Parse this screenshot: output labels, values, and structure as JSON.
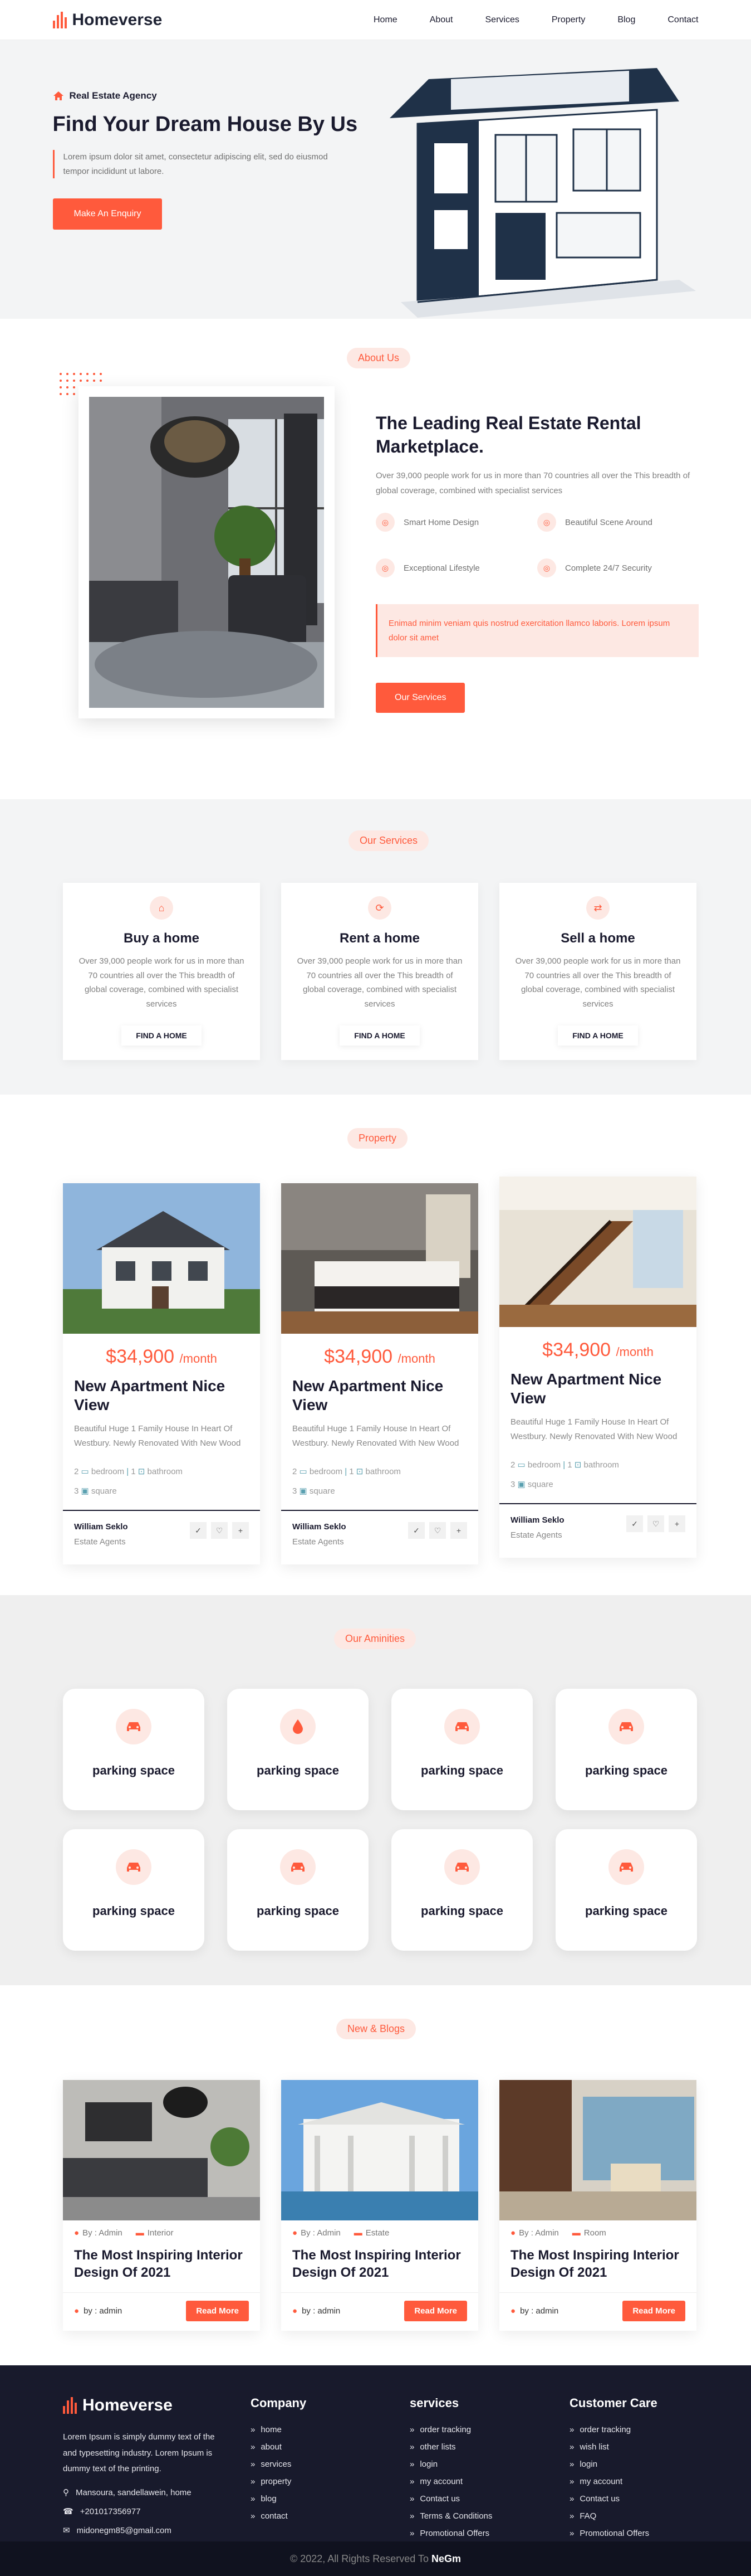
{
  "header": {
    "brand": "Homeverse",
    "nav": [
      "Home",
      "About",
      "Services",
      "Property",
      "Blog",
      "Contact"
    ]
  },
  "hero": {
    "eyebrow": "Real Estate Agency",
    "title": "Find Your Dream House By Us",
    "desc_line1": "Lorem ipsum dolor sit amet, consectetur adipiscing elit, sed do eiusmod",
    "desc_line2": "tempor incididunt ut labore.",
    "cta": "Make An Enquiry"
  },
  "about": {
    "tag": "About Us",
    "title": "The Leading Real Estate Rental Marketplace.",
    "text": "Over 39,000 people work for us in more than 70 countries all over the This breadth of global coverage, combined with specialist services",
    "features": [
      "Smart Home Design",
      "Beautiful Scene Around",
      "Exceptional Lifestyle",
      "Complete 24/7 Security"
    ],
    "quote": "Enimad minim veniam quis nostrud exercitation llamco laboris. Lorem ipsum dolor sit amet",
    "cta": "Our Services"
  },
  "services": {
    "tag": "Our Services",
    "items": [
      {
        "title": "Buy a home",
        "text": "Over 39,000 people work for us in more than 70 countries all over the This breadth of global coverage, combined with specialist services",
        "button": "FIND A HOME"
      },
      {
        "title": "Rent a home",
        "text": "Over 39,000 people work for us in more than 70 countries all over the This breadth of global coverage, combined with specialist services",
        "button": "FIND A HOME"
      },
      {
        "title": "Sell a home",
        "text": "Over 39,000 people work for us in more than 70 countries all over the This breadth of global coverage, combined with specialist services",
        "button": "FIND A HOME"
      }
    ]
  },
  "property": {
    "tag": "Property",
    "items": [
      {
        "price": "34,900",
        "per": "/month",
        "title": "New Apartment Nice View",
        "desc": "Beautiful Huge 1 Family House In Heart Of Westbury. Newly Renovated With New Wood",
        "beds": "2",
        "beds_label": "bedroom",
        "baths": "1",
        "baths_label": "bathroom",
        "area": "3",
        "area_label": "square",
        "agent": "William Seklo",
        "role": "Estate Agents"
      },
      {
        "price": "34,900",
        "per": "/month",
        "title": "New Apartment Nice View",
        "desc": "Beautiful Huge 1 Family House In Heart Of Westbury. Newly Renovated With New Wood",
        "beds": "2",
        "beds_label": "bedroom",
        "baths": "1",
        "baths_label": "bathroom",
        "area": "3",
        "area_label": "square",
        "agent": "William Seklo",
        "role": "Estate Agents"
      },
      {
        "price": "34,900",
        "per": "/month",
        "title": "New Apartment Nice View",
        "desc": "Beautiful Huge 1 Family House In Heart Of Westbury. Newly Renovated With New Wood",
        "beds": "2",
        "beds_label": "bedroom",
        "baths": "1",
        "baths_label": "bathroom",
        "area": "3",
        "area_label": "square",
        "agent": "William Seklo",
        "role": "Estate Agents"
      }
    ]
  },
  "amenities": {
    "tag": "Our Aminities",
    "items": [
      {
        "label": "parking space",
        "icon": "car-icon"
      },
      {
        "label": "parking space",
        "icon": "drop-icon"
      },
      {
        "label": "parking space",
        "icon": "car-icon"
      },
      {
        "label": "parking space",
        "icon": "car-icon"
      },
      {
        "label": "parking space",
        "icon": "car-icon"
      },
      {
        "label": "parking space",
        "icon": "car-icon"
      },
      {
        "label": "parking space",
        "icon": "car-icon"
      },
      {
        "label": "parking space",
        "icon": "car-icon"
      }
    ]
  },
  "blogs": {
    "tag": "New & Blogs",
    "items": [
      {
        "author": "By : Admin",
        "category": "Interior",
        "title": "The Most Inspiring Interior Design Of 2021",
        "by": "by : admin",
        "button": "Read More"
      },
      {
        "author": "By : Admin",
        "category": "Estate",
        "title": "The Most Inspiring Interior Design Of 2021",
        "by": "by : admin",
        "button": "Read More"
      },
      {
        "author": "By : Admin",
        "category": "Room",
        "title": "The Most Inspiring Interior Design Of 2021",
        "by": "by : admin",
        "button": "Read More"
      }
    ]
  },
  "footer": {
    "brand": "Homeverse",
    "about": "Lorem Ipsum is simply dummy text of the and typesetting industry. Lorem Ipsum is dummy text of the printing.",
    "address": "Mansoura, sandellawein, home",
    "phone": "+201017356977",
    "email": "midonegm85@gmail.com",
    "company": {
      "title": "Company",
      "links": [
        "home",
        "about",
        "services",
        "property",
        "blog",
        "contact"
      ]
    },
    "services": {
      "title": "services",
      "links": [
        "order tracking",
        "other lists",
        "login",
        "my account",
        "Contact us",
        "Terms & Conditions",
        "Promotional Offers"
      ]
    },
    "care": {
      "title": "Customer Care",
      "links": [
        "order tracking",
        "wish list",
        "login",
        "my account",
        "Contact us",
        "FAQ",
        "Promotional Offers"
      ]
    },
    "copyright": "© 2022, All Rights Reserved To",
    "copyright_name": "NeGm"
  },
  "colors": {
    "accent": "#ff5a3c",
    "dark": "#181a2c",
    "soft": "#fde8e3"
  }
}
